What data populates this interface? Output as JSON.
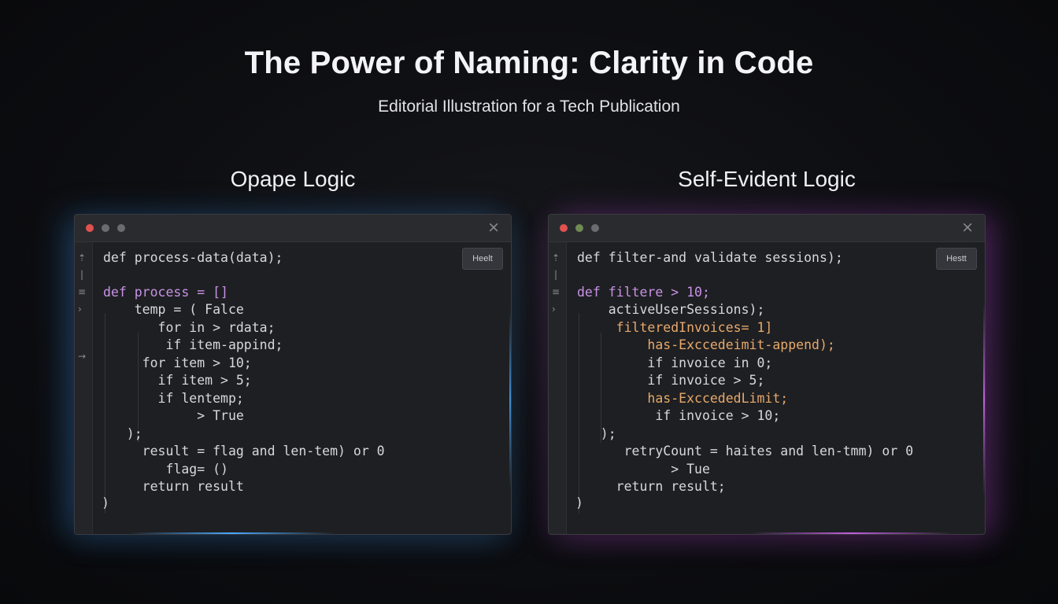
{
  "title": "The Power of Naming: Clarity in Code",
  "subtitle": "Editorial Illustration for a Tech Publication",
  "colors": {
    "accent_left": "#4aa8ff",
    "accent_right": "#c25ee0",
    "dot_red": "#e0524f",
    "dot_gray": "#6b6c70",
    "dot_green": "#6f8b52",
    "keyword": "#c893e6",
    "identifier_orange": "#e7a96b"
  },
  "left_panel": {
    "heading": "Opape Logic",
    "badge": "Heelt",
    "close_icon": "×",
    "gutter_icons": [
      "⇡",
      "|",
      "≡",
      "›",
      "→"
    ],
    "lines": [
      "def process-data(data);",
      "",
      "def process = []",
      "    temp = ( Falce",
      "       for in > rdata;",
      "        if item-appind;",
      "     for item > 10;",
      "       if item > 5;",
      "       if lentemp;",
      "            > True",
      "   );",
      "     result = flag and len-tem) or 0",
      "        flag= ()",
      "     return result",
      ")"
    ]
  },
  "right_panel": {
    "heading": "Self-Evident Logic",
    "badge": "Hestt",
    "close_icon": "×",
    "gutter_icons": [
      "⇡",
      "|",
      "≡",
      "›"
    ],
    "lines": [
      "def filter-and validate sessions);",
      "",
      "def filtere > 10;",
      "    activeUserSessions);",
      "     filteredInvoices= 1]",
      "         has-Exccedeimit-append);",
      "         if invoice in 0;",
      "         if invoice > 5;",
      "         has-ExccededLimit;",
      "          if invoice > 10;",
      "   );",
      "      retryCount = haites and len-tmm) or 0",
      "            > Tue",
      "     return result;",
      ")"
    ]
  }
}
